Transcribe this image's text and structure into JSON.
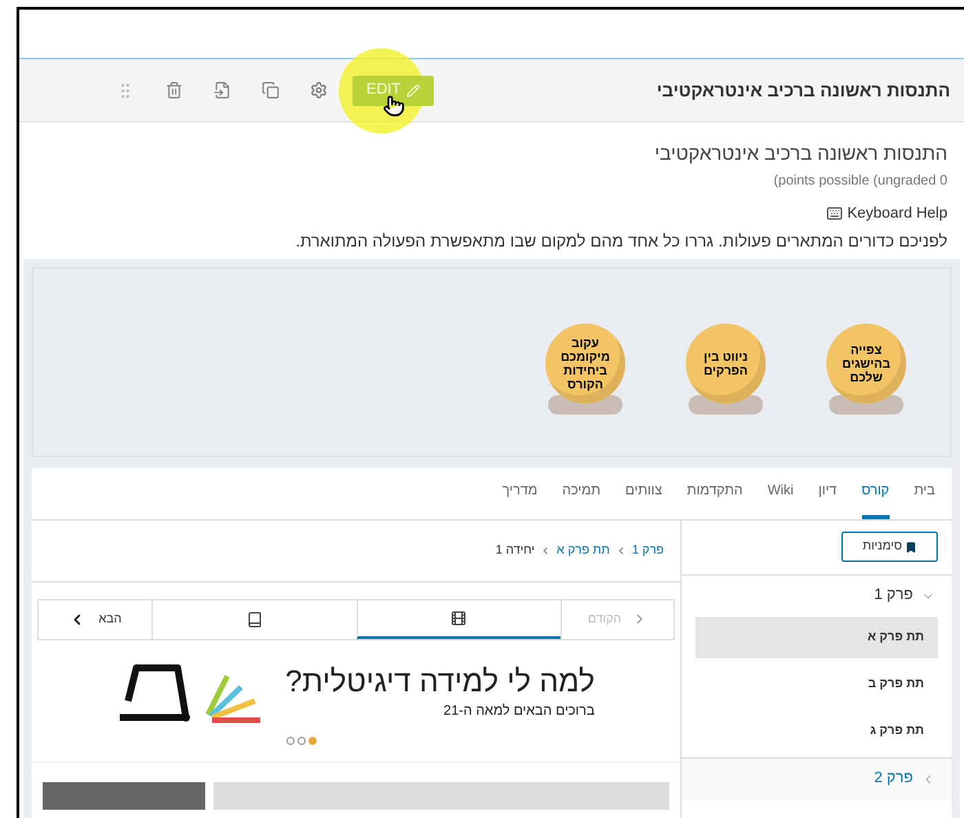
{
  "header": {
    "title": "התנסות ראשונה ברכיב אינטראקטיבי",
    "edit_button": "EDIT"
  },
  "problem": {
    "title": "התנסות ראשונה ברכיב אינטראקטיבי",
    "points": "(points possible (ungraded 0",
    "keyboard_help": "Keyboard Help",
    "instructions": "לפניכם כדורים המתארים פעולות. גררו כל אחד מהם למקום שבו מתאפשרת הפעולה המתוארת."
  },
  "balls": [
    {
      "label": "צפייה בהישגים שלכם"
    },
    {
      "label": "ניווט בין הפרקים"
    },
    {
      "label": "עקוב מיקומכם ביחידות הקורס"
    }
  ],
  "course_tabs": [
    {
      "label": "בית",
      "selected": false
    },
    {
      "label": "קורס",
      "selected": true
    },
    {
      "label": "דיון",
      "selected": false
    },
    {
      "label": "Wiki",
      "selected": false
    },
    {
      "label": "התקדמות",
      "selected": false
    },
    {
      "label": "צוותים",
      "selected": false
    },
    {
      "label": "תמיכה",
      "selected": false
    },
    {
      "label": "מדריך",
      "selected": false
    }
  ],
  "sidebar": {
    "bookmarks_button": "סימניות",
    "chapters": [
      {
        "title": "פרק 1",
        "expanded": true,
        "children": [
          {
            "title": "תת פרק א",
            "selected": true
          },
          {
            "title": "תת פרק ב",
            "selected": false
          },
          {
            "title": "תת פרק ג",
            "selected": false
          }
        ]
      },
      {
        "title": "פרק 2",
        "expanded": false
      }
    ]
  },
  "breadcrumb": [
    {
      "label": "פרק 1",
      "kind": "link"
    },
    {
      "label": "תת פרק א",
      "kind": "link"
    },
    {
      "label": "יחידה 1",
      "kind": "current"
    }
  ],
  "sequence_nav": {
    "previous": {
      "label": "הקודם",
      "disabled": true
    },
    "next": {
      "label": "הבא",
      "disabled": false
    },
    "units": [
      {
        "kind": "video",
        "selected": true
      },
      {
        "kind": "book",
        "selected": false
      }
    ]
  },
  "banner": {
    "title": "למה לי למידה דיגיטלית?",
    "subtitle": "ברוכים הבאים למאה ה-21",
    "dots": [
      {
        "selected": true
      },
      {
        "selected": false
      },
      {
        "selected": false
      }
    ]
  }
}
